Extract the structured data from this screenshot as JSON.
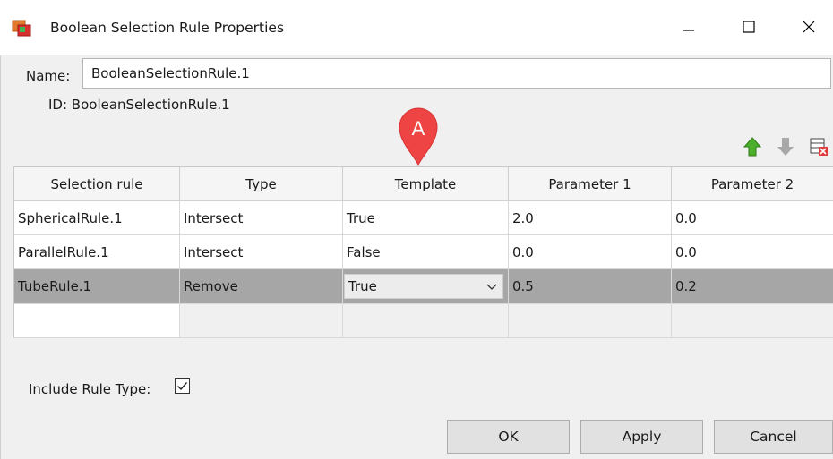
{
  "window": {
    "title": "Boolean Selection Rule Properties",
    "icon": "app-icon",
    "controls": [
      "minimize-icon",
      "maximize-icon",
      "close-icon"
    ]
  },
  "form": {
    "name_label": "Name:",
    "name_value": "BooleanSelectionRule.1",
    "id_label": "ID: BooleanSelectionRule.1"
  },
  "callout": {
    "letter": "A",
    "color": "#ef4444"
  },
  "toolbar": {
    "icons": [
      "move-up-icon",
      "move-down-icon",
      "delete-row-icon"
    ]
  },
  "table": {
    "headers": [
      "Selection rule",
      "Type",
      "Template",
      "Parameter 1",
      "Parameter 2"
    ],
    "rows": [
      [
        "SphericalRule.1",
        "Intersect",
        "True",
        "2.0",
        "0.0"
      ],
      [
        "ParallelRule.1",
        "Intersect",
        "False",
        "0.0",
        "0.0"
      ],
      [
        "TubeRule.1",
        "Remove",
        "True",
        "0.5",
        "0.2"
      ]
    ],
    "selected_row": 2,
    "selected_color": "#a6a6a6"
  },
  "options": {
    "include_rule_type_label": "Include Rule Type:",
    "include_rule_type_checked": true
  },
  "buttons": {
    "ok": "OK",
    "apply": "Apply",
    "cancel": "Cancel"
  }
}
